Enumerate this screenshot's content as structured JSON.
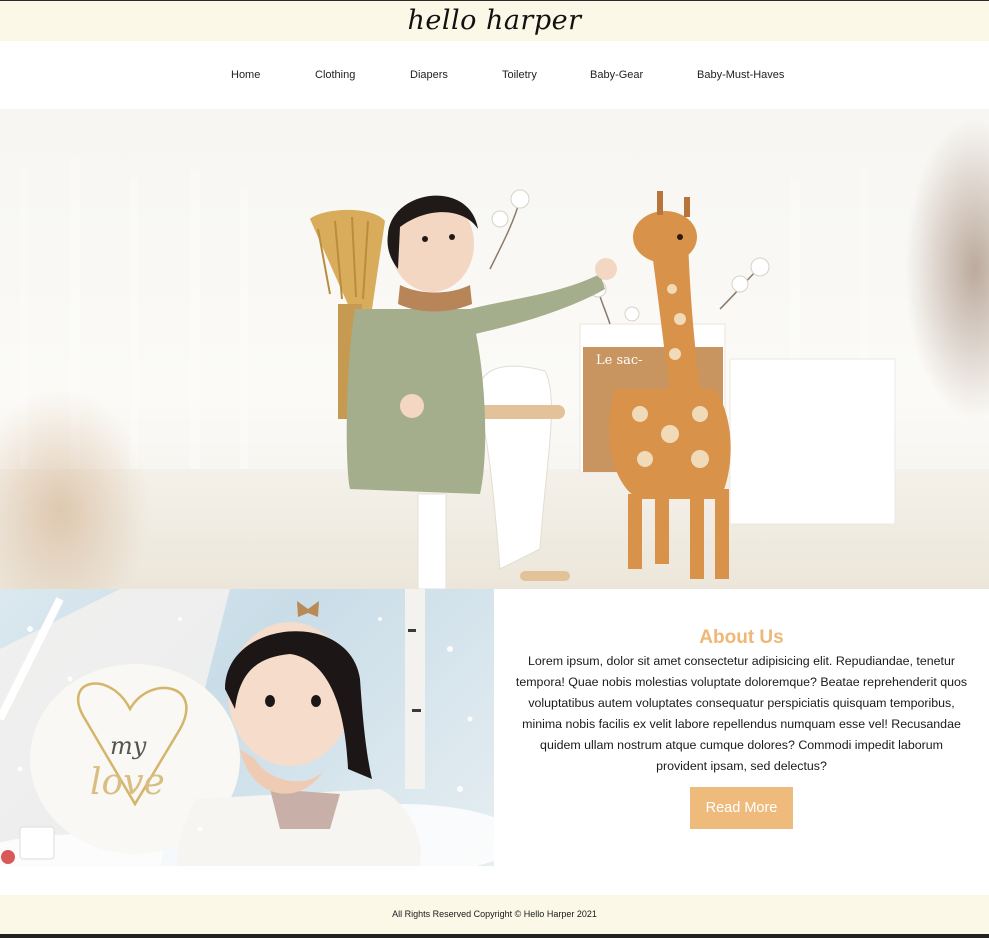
{
  "header": {
    "logo": "hello harper"
  },
  "nav": {
    "items": [
      {
        "label": "Home"
      },
      {
        "label": "Clothing"
      },
      {
        "label": "Diapers"
      },
      {
        "label": "Toiletry"
      },
      {
        "label": "Baby-Gear"
      },
      {
        "label": "Baby-Must-Haves"
      }
    ]
  },
  "hero": {
    "box_sign": "Le sac-"
  },
  "about": {
    "title": "About Us",
    "body": "Lorem ipsum, dolor sit amet consectetur adipisicing elit. Repudiandae, tenetur tempora! Quae nobis molestias voluptate doloremque? Beatae reprehenderit quos voluptatibus autem voluptates consequatur perspiciatis quisquam temporibus, minima nobis facilis ex velit labore repellendus numquam esse vel! Recusandae quidem ullam nostrum atque cumque dolores? Commodi impedit laborum provident ipsam, sed delectus?",
    "button": "Read More",
    "pillow_text_1": "my",
    "pillow_text_2": "love"
  },
  "footer": {
    "copyright": "All Rights Reserved Copyright © Hello Harper 2021"
  },
  "colors": {
    "header_bg": "#fbf8e8",
    "accent": "#efbb7d",
    "title": "#eeb877"
  }
}
